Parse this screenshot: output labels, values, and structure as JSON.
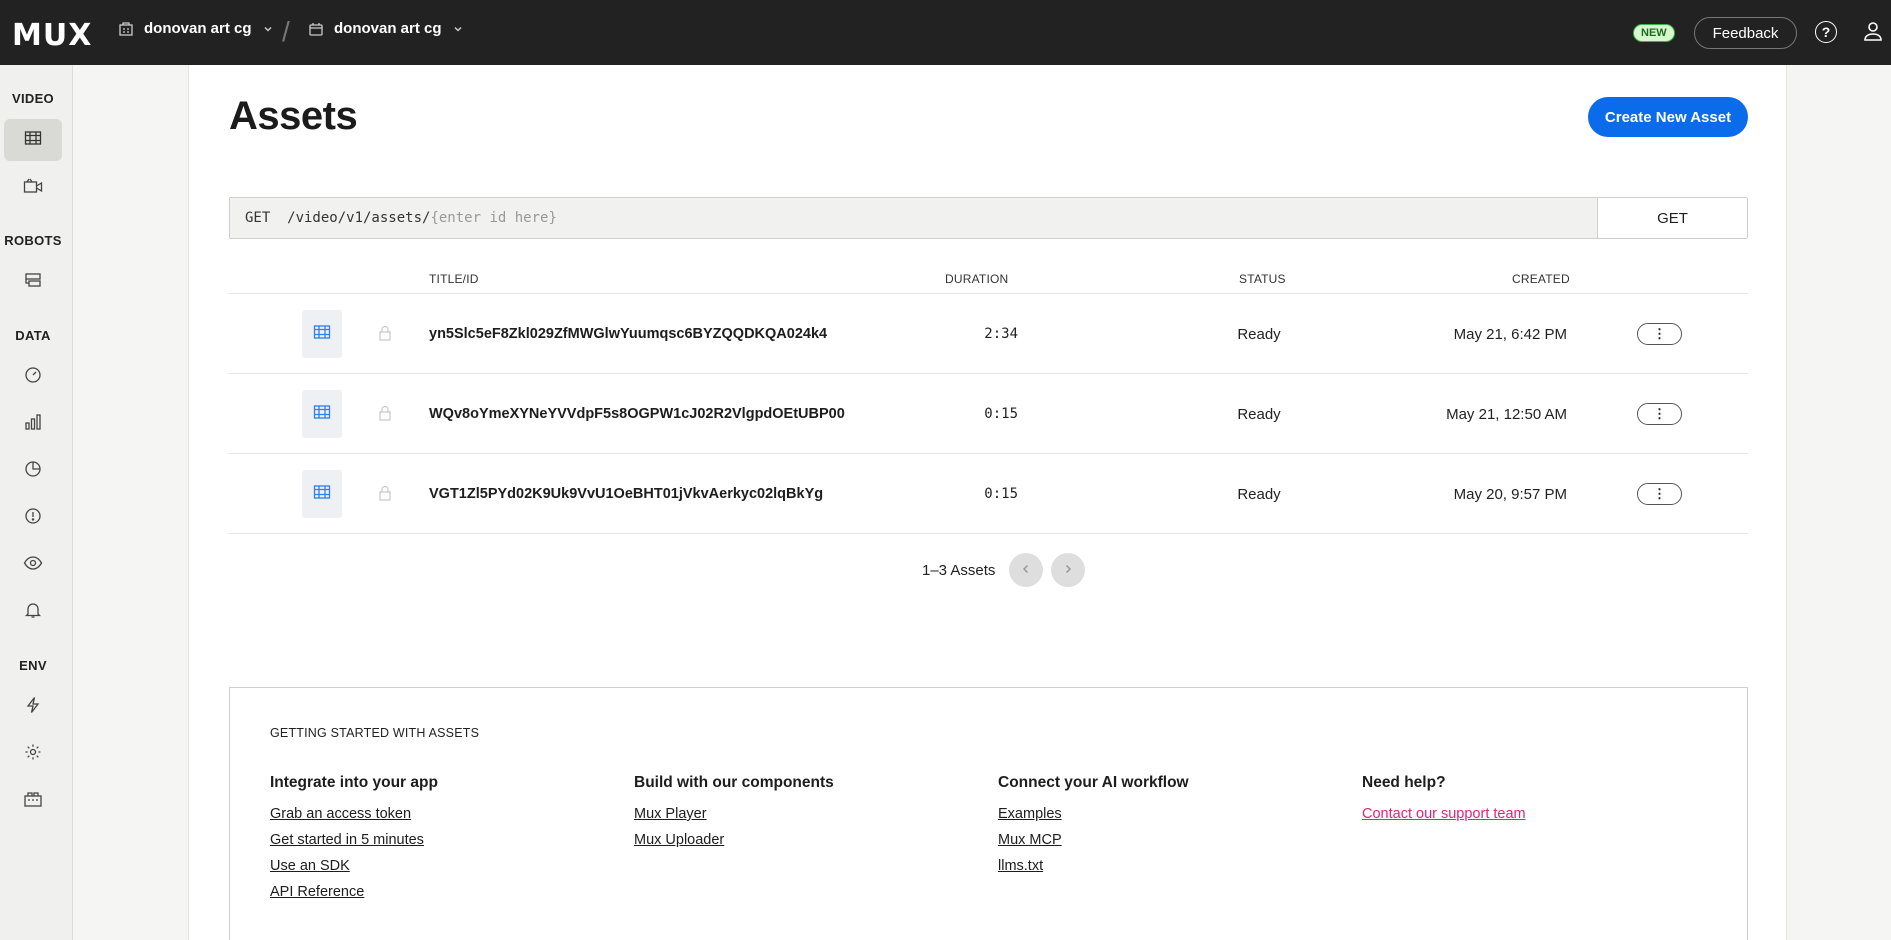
{
  "app": {
    "logo": "MUX"
  },
  "topbar": {
    "org": "donovan art cg",
    "env": "donovan art cg",
    "separator": "/",
    "new_badge": "NEW",
    "feedback": "Feedback",
    "help": "?"
  },
  "sidebar": {
    "sections": [
      "VIDEO",
      "ROBOTS",
      "DATA",
      "ENV"
    ]
  },
  "main": {
    "title": "Assets",
    "create_button": "Create New Asset",
    "api": {
      "prefix": "GET  /video/v1/assets/",
      "placeholder": "{enter id here}",
      "button": "GET"
    },
    "table": {
      "headers": {
        "title": "TITLE/ID",
        "duration": "DURATION",
        "status": "STATUS",
        "created": "CREATED"
      },
      "rows": [
        {
          "id": "yn5Slc5eF8Zkl029ZfMWGlwYuumqsc6BYZQQDKQA024k4",
          "duration": "2:34",
          "status": "Ready",
          "created": "May 21, 6:42 PM"
        },
        {
          "id": "WQv8oYmeXYNeYVVdpF5s8OGPW1cJ02R2VlgpdOEtUBP00",
          "duration": "0:15",
          "status": "Ready",
          "created": "May 21, 12:50 AM"
        },
        {
          "id": "VGT1Zl5PYd02K9Uk9VvU1OeBHT01jVkvAerkyc02lqBkYg",
          "duration": "0:15",
          "status": "Ready",
          "created": "May 20, 9:57 PM"
        }
      ],
      "menu_glyph": "⋮"
    },
    "pager": {
      "text": "1–3 Assets"
    }
  },
  "getting_started": {
    "title": "GETTING STARTED WITH ASSETS",
    "columns": [
      {
        "heading": "Integrate into your app",
        "links": [
          "Grab an access token",
          "Get started in 5 minutes",
          "Use an SDK",
          "API Reference"
        ]
      },
      {
        "heading": "Build with our components",
        "links": [
          "Mux Player",
          "Mux Uploader"
        ]
      },
      {
        "heading": "Connect your AI workflow",
        "links": [
          "Examples",
          "Mux MCP",
          "llms.txt"
        ]
      },
      {
        "heading": "Need help?",
        "links": [
          "Contact our support team"
        ]
      }
    ]
  },
  "colors": {
    "accent": "#0a6cea",
    "topbar": "#222222",
    "support_link": "#e0237a",
    "new_badge_bg": "#d7f8cf"
  }
}
